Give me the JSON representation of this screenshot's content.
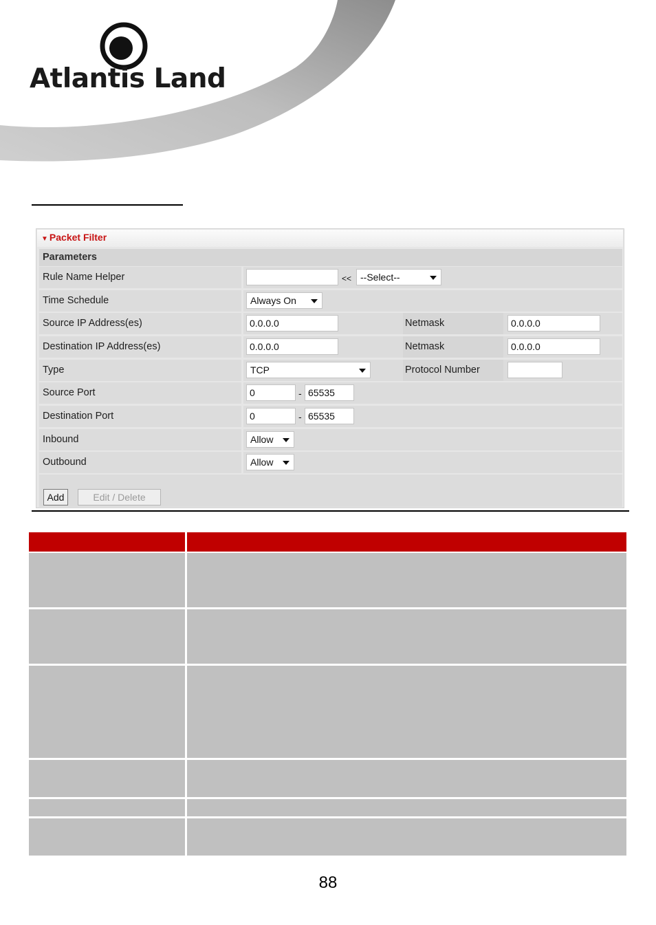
{
  "brand": {
    "logo_text": "Atlantis Land",
    "logo_icon": "atlantis-circle-logo"
  },
  "panel": {
    "title": "Packet Filter",
    "section": "Parameters",
    "rows": {
      "rule_name": {
        "label": "Rule Name  Helper",
        "value": "",
        "arrows": "<<",
        "select": "--Select--"
      },
      "time_schedule": {
        "label": "Time Schedule",
        "select": "Always On"
      },
      "source_ip": {
        "label": "Source IP Address(es)",
        "value": "0.0.0.0",
        "netmask_label": "Netmask",
        "netmask": "0.0.0.0"
      },
      "destination_ip": {
        "label": "Destination IP Address(es)",
        "value": "0.0.0.0",
        "netmask_label": "Netmask",
        "netmask": "0.0.0.0"
      },
      "type": {
        "label": "Type",
        "select": "TCP",
        "protocol_label": "Protocol Number",
        "protocol": ""
      },
      "source_port": {
        "label": "Source Port",
        "from": "0",
        "sep": "-",
        "to": "65535"
      },
      "destination_port": {
        "label": "Destination Port",
        "from": "0",
        "sep": "-",
        "to": "65535"
      },
      "inbound": {
        "label": "Inbound",
        "select": "Allow"
      },
      "outbound": {
        "label": "Outbound",
        "select": "Allow"
      }
    },
    "buttons": {
      "add": "Add",
      "edit_delete": "Edit / Delete"
    }
  },
  "page_number": "88",
  "colors": {
    "table_header": "#c00000",
    "table_cell": "#c0c0c0",
    "panel_title": "#c81414"
  }
}
